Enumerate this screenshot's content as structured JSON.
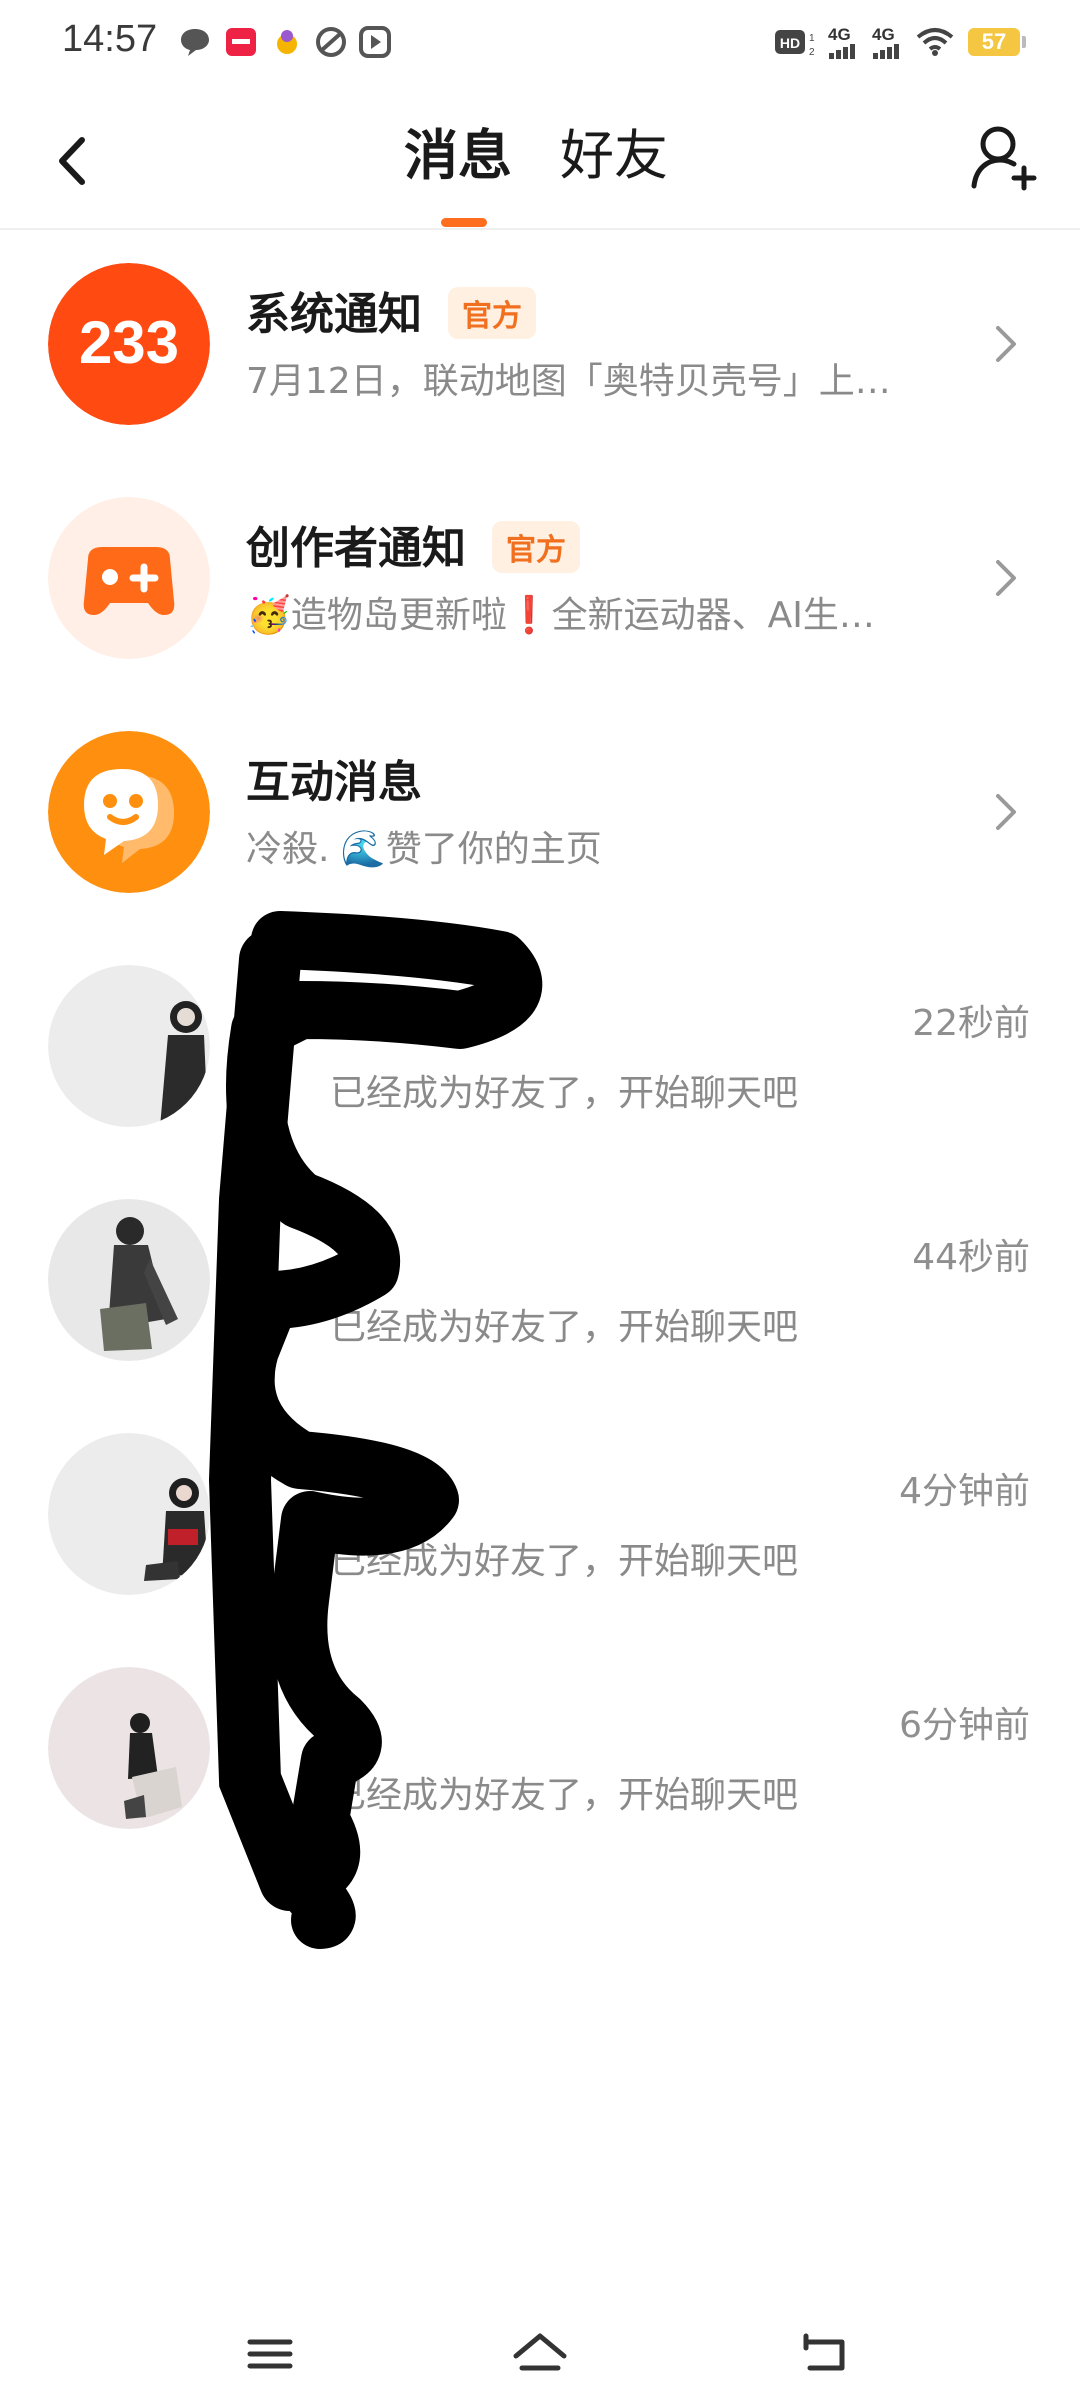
{
  "status_bar": {
    "time": "14:57",
    "left_icons": [
      "chat-bubble-icon",
      "app-notification-icon",
      "app-notification-icon",
      "app-notification-icon",
      "play-icon"
    ],
    "network_1": "4G",
    "network_2": "4G",
    "hd_label": "HD",
    "battery": "57"
  },
  "header": {
    "back_icon": "chevron-left-icon",
    "tabs": [
      {
        "label": "消息",
        "active": true
      },
      {
        "label": "好友",
        "active": false
      }
    ],
    "add_friend_icon": "add-user-icon",
    "accent_color": "#ff6d1f"
  },
  "notifications": [
    {
      "title": "系统通知",
      "badge": "官方",
      "subtitle": "7月12日，联动地图「奥特贝壳号」上…",
      "avatar_text": "233",
      "avatar_color": "#ff4a12"
    },
    {
      "title": "创作者通知",
      "badge": "官方",
      "subtitle": "🥳造物岛更新啦❗全新运动器、AI生…",
      "avatar_icon": "gamepad-icon",
      "avatar_color": "#ffefe6"
    },
    {
      "title": "互动消息",
      "badge": "",
      "subtitle": "冷殺. 🌊赞了你的主页",
      "avatar_icon": "chat-smile-icon",
      "avatar_color": "#ff8f0f"
    }
  ],
  "chats": [
    {
      "time": "22秒前",
      "message": "已经成为好友了，开始聊天吧"
    },
    {
      "time": "44秒前",
      "message": "已经成为好友了，开始聊天吧"
    },
    {
      "time": "4分钟前",
      "message": "已经成为好友了，开始聊天吧"
    },
    {
      "time": "6分钟前",
      "message": "已经成为好友了，开始聊天吧"
    }
  ],
  "nav_bar": {
    "icons": [
      "menu-icon",
      "home-icon",
      "back-icon"
    ]
  }
}
